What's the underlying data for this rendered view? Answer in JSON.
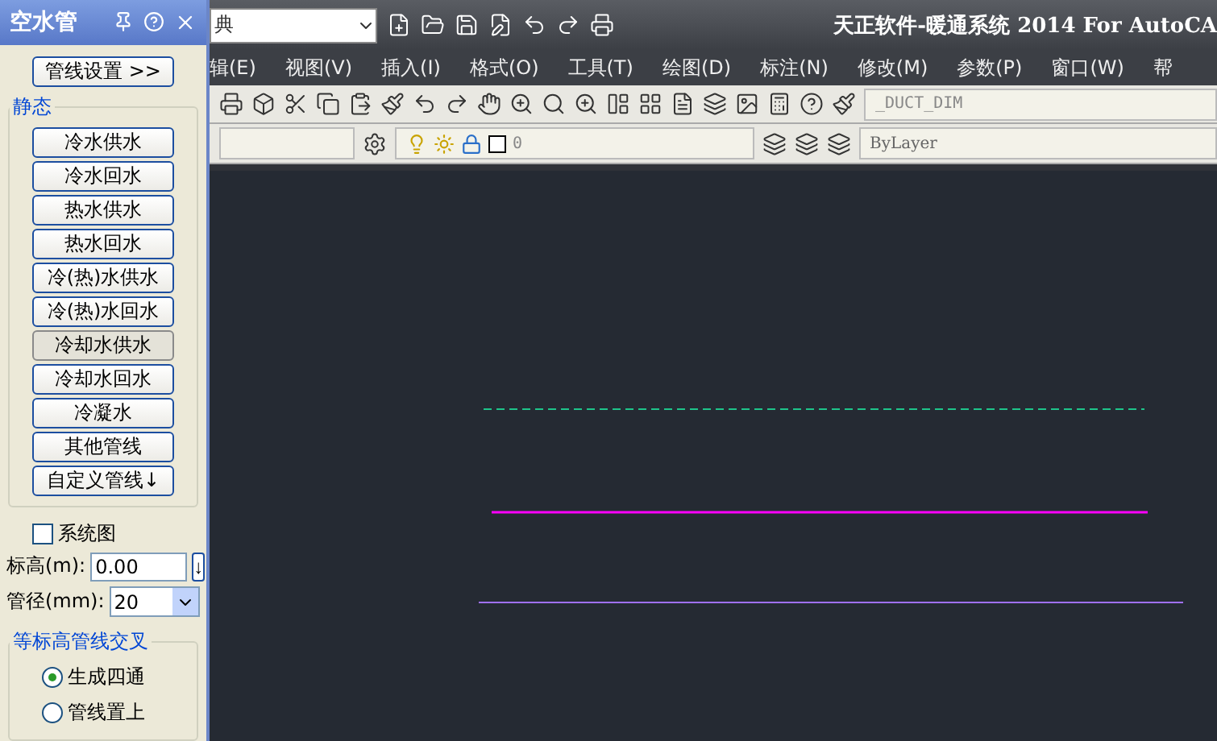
{
  "app_title": "天正软件-暖通系统 2014 For AutoCA",
  "workspace": {
    "value": "典"
  },
  "menu": [
    "辑(E)",
    "视图(V)",
    "插入(I)",
    "格式(O)",
    "工具(T)",
    "绘图(D)",
    "标注(N)",
    "修改(M)",
    "参数(P)",
    "窗口(W)",
    "帮"
  ],
  "dim_style": {
    "value": "_DUCT_DIM"
  },
  "layer": {
    "value": "0"
  },
  "color_combo": {
    "value": "ByLayer"
  },
  "panel": {
    "title": "空水管",
    "settings_button": "管线设置 >>",
    "group_label": "静态",
    "pipe_buttons": [
      {
        "label": "冷水供水",
        "selected": false
      },
      {
        "label": "冷水回水",
        "selected": false
      },
      {
        "label": "热水供水",
        "selected": false
      },
      {
        "label": "热水回水",
        "selected": false
      },
      {
        "label": "冷(热)水供水",
        "selected": false
      },
      {
        "label": "冷(热)水回水",
        "selected": false
      },
      {
        "label": "冷却水供水",
        "selected": true
      },
      {
        "label": "冷却水回水",
        "selected": false
      },
      {
        "label": "冷凝水",
        "selected": false
      },
      {
        "label": "其他管线",
        "selected": false
      }
    ],
    "custom_button": "自定义管线↓",
    "system_checkbox": {
      "label": "系统图",
      "checked": false
    },
    "elevation": {
      "label": "标高(m):",
      "value": "0.00",
      "button": "↓"
    },
    "diameter": {
      "label": "管径(mm):",
      "value": "20"
    },
    "cross_group": "等标高管线交叉",
    "cross_options": [
      {
        "label": "生成四通",
        "selected": true
      },
      {
        "label": "管线置上",
        "selected": false
      }
    ]
  }
}
